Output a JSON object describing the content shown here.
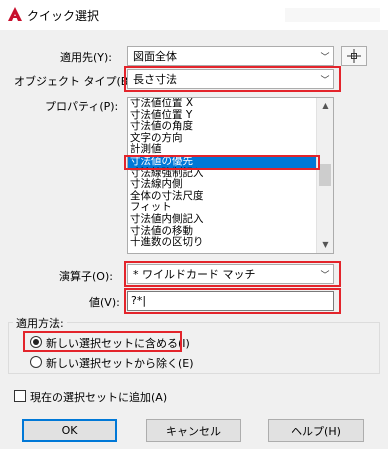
{
  "window": {
    "title": "クイック選択"
  },
  "apply_to": {
    "label": "適用先(Y):",
    "value": "図面全体"
  },
  "object_type": {
    "label": "オブジェクト タイプ(B):",
    "value": "長さ寸法"
  },
  "properties": {
    "label": "プロパティ(P):",
    "items": [
      "寸法値位置 X",
      "寸法値位置 Y",
      "寸法値の角度",
      "文字の方向",
      "計測値",
      "寸法値の優先",
      "寸法線強制記入",
      "寸法線内側",
      "全体の寸法尺度",
      "フィット",
      "寸法値内側記入",
      "寸法値の移動",
      "十進数の区切り"
    ],
    "selected_index": 5
  },
  "operator": {
    "label": "演算子(O):",
    "value": "* ワイルドカード マッチ"
  },
  "value_field": {
    "label": "値(V):",
    "value": "?*|"
  },
  "how_to_apply": {
    "title": "適用方法:",
    "option_include": "新しい選択セットに含める(I)",
    "option_exclude": "新しい選択セットから除く(E)"
  },
  "append": {
    "label": "現在の選択セットに追加(A)"
  },
  "buttons": {
    "ok": "OK",
    "cancel": "キャンセル",
    "help": "ヘルプ(H)"
  },
  "colors": {
    "highlight": "#e3242b",
    "selection": "#0078d7",
    "autocad_red": "#c8102e"
  },
  "icons": {
    "app": "autocad-logo-icon",
    "pick": "crosshair-select-icon"
  }
}
